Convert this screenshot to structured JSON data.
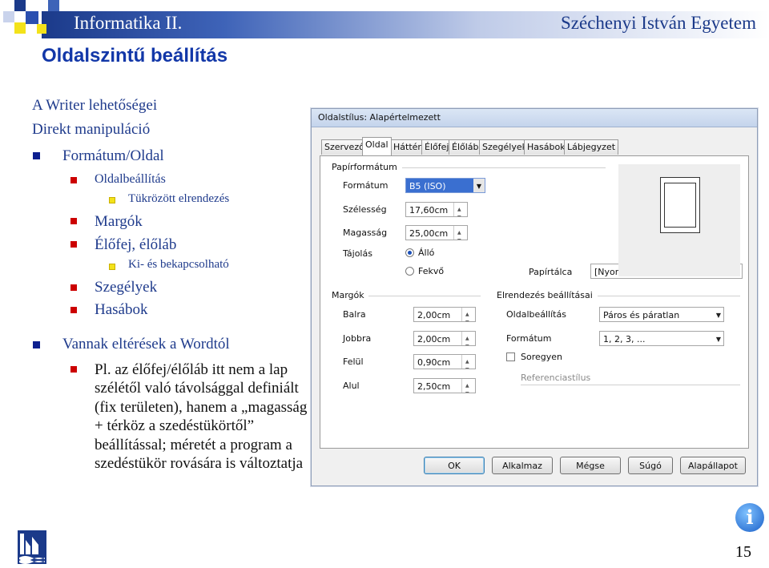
{
  "header": {
    "course": "Informatika II.",
    "university": "Széchenyi István Egyetem"
  },
  "slide": {
    "title": "Oldalszintű beállítás",
    "lines": [
      "A Writer lehetőségei",
      "Direkt manipuláció",
      "Formátum/Oldal",
      "Oldalbeállítás",
      "Tükrözött elrendezés",
      "Margók",
      "Élőfej, élőláb",
      "Ki- és bekapcsolható",
      "Szegélyek",
      "Hasábok",
      "Vannak eltérések a Wordtól"
    ],
    "paragraph": "Pl. az élőfej/élőláb itt nem a lap szélétől való távolsággal definiált (fix területen), hanem a „magasság + térköz a szedéstükörtől” beállítással; méretét a program a szedéstükör rovására is változtatja",
    "page_number": "15",
    "info_glyph": "i"
  },
  "dialog": {
    "title": "Oldalstílus: Alapértelmezett",
    "tabs": [
      "Szervező",
      "Oldal",
      "Háttér",
      "Élőfej",
      "Élőláb",
      "Szegélyek",
      "Hasábok",
      "Lábjegyzet"
    ],
    "active_tab": "Oldal",
    "paper_format": {
      "heading": "Papírformátum",
      "format_label": "Formátum",
      "format_value": "B5 (ISO)",
      "width_label": "Szélesség",
      "width_value": "17,60cm",
      "height_label": "Magasság",
      "height_value": "25,00cm",
      "orientation_label": "Tájolás",
      "portrait_label": "Álló",
      "landscape_label": "Fekvő",
      "portrait_selected": true,
      "tray_label": "Papírtálca",
      "tray_value": "[Nyomtatóbeállítások alapján]"
    },
    "margins": {
      "heading": "Margók",
      "left_label": "Balra",
      "left_value": "2,00cm",
      "right_label": "Jobbra",
      "right_value": "2,00cm",
      "top_label": "Felül",
      "top_value": "0,90cm",
      "bottom_label": "Alul",
      "bottom_value": "2,50cm"
    },
    "layout": {
      "heading": "Elrendezés beállításai",
      "page_layout_label": "Oldalbeállítás",
      "page_layout_value": "Páros és páratlan",
      "format_label": "Formátum",
      "format_value": "1, 2, 3, ...",
      "register_label": "Soregyen",
      "register_checked": false,
      "reference_label": "Referenciastílus"
    },
    "buttons": [
      "OK",
      "Alkalmaz",
      "Mégse",
      "Súgó",
      "Alapállapot"
    ]
  },
  "colors": {
    "title": "#1237a8",
    "text": "#1f3b8c",
    "bullet_level1": "#0d1f8f",
    "bullet_level2": "#cc0000",
    "bullet_level3": "#f3e21a"
  }
}
